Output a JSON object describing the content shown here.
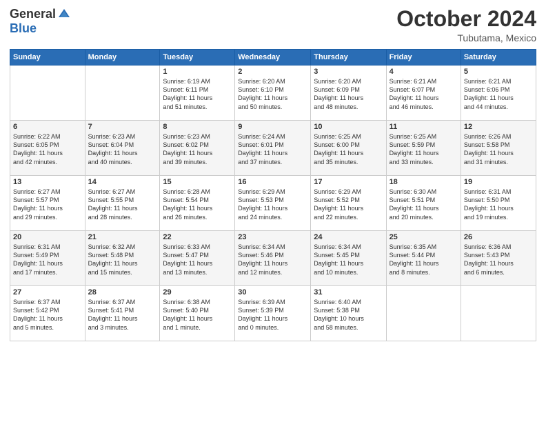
{
  "header": {
    "logo_general": "General",
    "logo_blue": "Blue",
    "month": "October 2024",
    "location": "Tubutama, Mexico"
  },
  "weekdays": [
    "Sunday",
    "Monday",
    "Tuesday",
    "Wednesday",
    "Thursday",
    "Friday",
    "Saturday"
  ],
  "weeks": [
    [
      {
        "day": "",
        "text": ""
      },
      {
        "day": "",
        "text": ""
      },
      {
        "day": "1",
        "text": "Sunrise: 6:19 AM\nSunset: 6:11 PM\nDaylight: 11 hours\nand 51 minutes."
      },
      {
        "day": "2",
        "text": "Sunrise: 6:20 AM\nSunset: 6:10 PM\nDaylight: 11 hours\nand 50 minutes."
      },
      {
        "day": "3",
        "text": "Sunrise: 6:20 AM\nSunset: 6:09 PM\nDaylight: 11 hours\nand 48 minutes."
      },
      {
        "day": "4",
        "text": "Sunrise: 6:21 AM\nSunset: 6:07 PM\nDaylight: 11 hours\nand 46 minutes."
      },
      {
        "day": "5",
        "text": "Sunrise: 6:21 AM\nSunset: 6:06 PM\nDaylight: 11 hours\nand 44 minutes."
      }
    ],
    [
      {
        "day": "6",
        "text": "Sunrise: 6:22 AM\nSunset: 6:05 PM\nDaylight: 11 hours\nand 42 minutes."
      },
      {
        "day": "7",
        "text": "Sunrise: 6:23 AM\nSunset: 6:04 PM\nDaylight: 11 hours\nand 40 minutes."
      },
      {
        "day": "8",
        "text": "Sunrise: 6:23 AM\nSunset: 6:02 PM\nDaylight: 11 hours\nand 39 minutes."
      },
      {
        "day": "9",
        "text": "Sunrise: 6:24 AM\nSunset: 6:01 PM\nDaylight: 11 hours\nand 37 minutes."
      },
      {
        "day": "10",
        "text": "Sunrise: 6:25 AM\nSunset: 6:00 PM\nDaylight: 11 hours\nand 35 minutes."
      },
      {
        "day": "11",
        "text": "Sunrise: 6:25 AM\nSunset: 5:59 PM\nDaylight: 11 hours\nand 33 minutes."
      },
      {
        "day": "12",
        "text": "Sunrise: 6:26 AM\nSunset: 5:58 PM\nDaylight: 11 hours\nand 31 minutes."
      }
    ],
    [
      {
        "day": "13",
        "text": "Sunrise: 6:27 AM\nSunset: 5:57 PM\nDaylight: 11 hours\nand 29 minutes."
      },
      {
        "day": "14",
        "text": "Sunrise: 6:27 AM\nSunset: 5:55 PM\nDaylight: 11 hours\nand 28 minutes."
      },
      {
        "day": "15",
        "text": "Sunrise: 6:28 AM\nSunset: 5:54 PM\nDaylight: 11 hours\nand 26 minutes."
      },
      {
        "day": "16",
        "text": "Sunrise: 6:29 AM\nSunset: 5:53 PM\nDaylight: 11 hours\nand 24 minutes."
      },
      {
        "day": "17",
        "text": "Sunrise: 6:29 AM\nSunset: 5:52 PM\nDaylight: 11 hours\nand 22 minutes."
      },
      {
        "day": "18",
        "text": "Sunrise: 6:30 AM\nSunset: 5:51 PM\nDaylight: 11 hours\nand 20 minutes."
      },
      {
        "day": "19",
        "text": "Sunrise: 6:31 AM\nSunset: 5:50 PM\nDaylight: 11 hours\nand 19 minutes."
      }
    ],
    [
      {
        "day": "20",
        "text": "Sunrise: 6:31 AM\nSunset: 5:49 PM\nDaylight: 11 hours\nand 17 minutes."
      },
      {
        "day": "21",
        "text": "Sunrise: 6:32 AM\nSunset: 5:48 PM\nDaylight: 11 hours\nand 15 minutes."
      },
      {
        "day": "22",
        "text": "Sunrise: 6:33 AM\nSunset: 5:47 PM\nDaylight: 11 hours\nand 13 minutes."
      },
      {
        "day": "23",
        "text": "Sunrise: 6:34 AM\nSunset: 5:46 PM\nDaylight: 11 hours\nand 12 minutes."
      },
      {
        "day": "24",
        "text": "Sunrise: 6:34 AM\nSunset: 5:45 PM\nDaylight: 11 hours\nand 10 minutes."
      },
      {
        "day": "25",
        "text": "Sunrise: 6:35 AM\nSunset: 5:44 PM\nDaylight: 11 hours\nand 8 minutes."
      },
      {
        "day": "26",
        "text": "Sunrise: 6:36 AM\nSunset: 5:43 PM\nDaylight: 11 hours\nand 6 minutes."
      }
    ],
    [
      {
        "day": "27",
        "text": "Sunrise: 6:37 AM\nSunset: 5:42 PM\nDaylight: 11 hours\nand 5 minutes."
      },
      {
        "day": "28",
        "text": "Sunrise: 6:37 AM\nSunset: 5:41 PM\nDaylight: 11 hours\nand 3 minutes."
      },
      {
        "day": "29",
        "text": "Sunrise: 6:38 AM\nSunset: 5:40 PM\nDaylight: 11 hours\nand 1 minute."
      },
      {
        "day": "30",
        "text": "Sunrise: 6:39 AM\nSunset: 5:39 PM\nDaylight: 11 hours\nand 0 minutes."
      },
      {
        "day": "31",
        "text": "Sunrise: 6:40 AM\nSunset: 5:38 PM\nDaylight: 10 hours\nand 58 minutes."
      },
      {
        "day": "",
        "text": ""
      },
      {
        "day": "",
        "text": ""
      }
    ]
  ]
}
